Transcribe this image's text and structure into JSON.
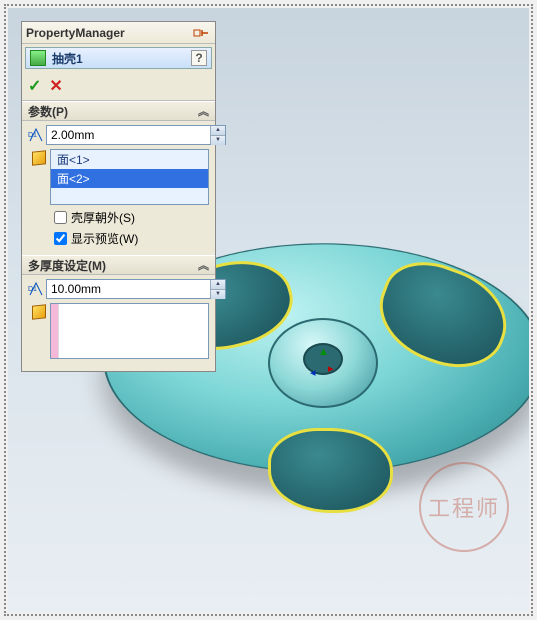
{
  "pm": {
    "title": "PropertyManager"
  },
  "feature": {
    "name": "抽壳1",
    "help": "?"
  },
  "actions": {
    "ok": "✓",
    "cancel": "✕"
  },
  "params": {
    "header": "参数(P)",
    "thickness": "2.00mm",
    "faces": [
      "面<1>",
      "面<2>"
    ],
    "selected_index": 1,
    "shell_outward": {
      "label": "壳厚朝外(S)",
      "checked": false
    },
    "show_preview": {
      "label": "显示预览(W)",
      "checked": true
    }
  },
  "multi": {
    "header": "多厚度设定(M)",
    "thickness": "10.00mm"
  },
  "watermark": "工程师"
}
